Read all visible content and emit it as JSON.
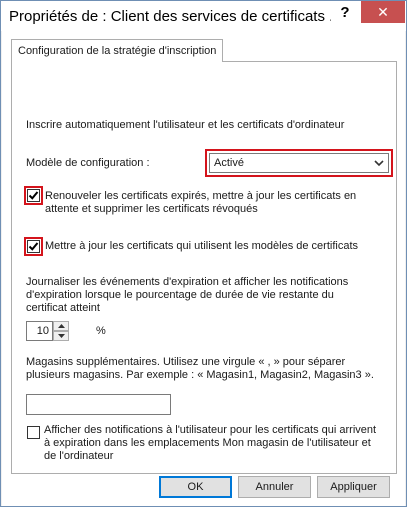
{
  "window": {
    "title": "Propriétés de : Client des services de certificats ...",
    "help_glyph": "?",
    "close_glyph": "✕"
  },
  "tab": {
    "label": "Configuration de la stratégie d'inscription"
  },
  "panel": {
    "intro": "Inscrire automatiquement l'utilisateur et les certificats d'ordinateur",
    "config_model_label": "Modèle de configuration :",
    "config_model_value": "Activé",
    "renew_checkbox": {
      "label": "Renouveler les certificats expirés, mettre à jour les certificats en attente et supprimer les certificats révoqués",
      "checked": true
    },
    "update_checkbox": {
      "label": "Mettre à jour les certificats qui utilisent les modèles de certificats",
      "checked": true
    },
    "log_text": "Journaliser les événements d'expiration et afficher les notifications d'expiration lorsque le pourcentage de durée de vie restante du certificat atteint",
    "percent_value": "10",
    "percent_unit": "%",
    "stores_text": "Magasins supplémentaires. Utilisez une virgule « , » pour séparer plusieurs magasins. Par exemple : « Magasin1, Magasin2, Magasin3 ».",
    "stores_value": "",
    "notify_checkbox": {
      "label": "Afficher des notifications à l'utilisateur pour les certificats qui arrivent à expiration dans les emplacements Mon magasin de l'utilisateur et de l'ordinateur",
      "checked": false
    }
  },
  "buttons": {
    "ok": "OK",
    "cancel": "Annuler",
    "apply": "Appliquer"
  },
  "colors": {
    "highlight": "#d4141c",
    "close_bg": "#c75050",
    "accent": "#0078d7"
  }
}
